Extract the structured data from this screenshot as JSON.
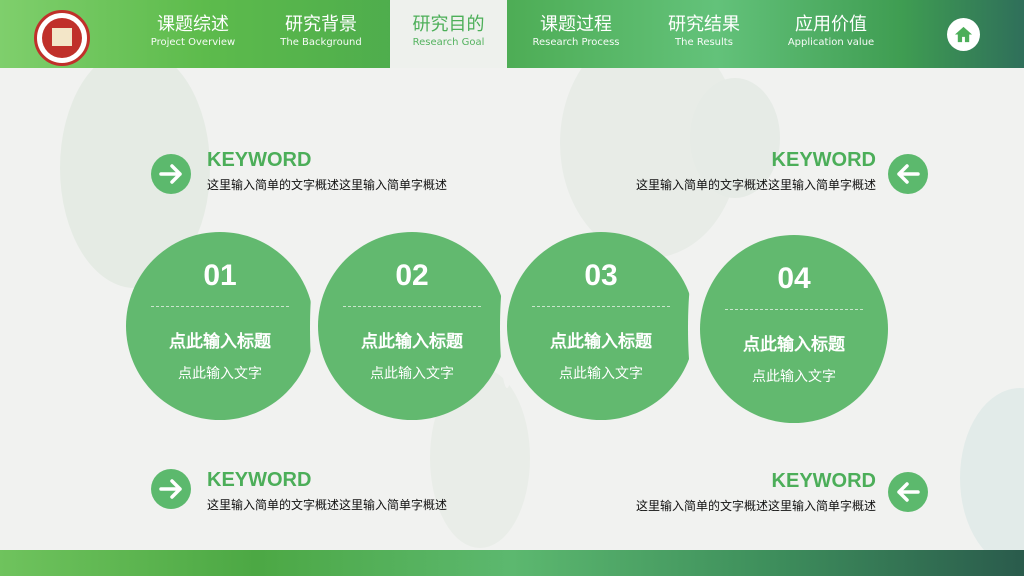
{
  "nav": {
    "items": [
      {
        "zh": "课题综述",
        "en": "Project Overview"
      },
      {
        "zh": "研究背景",
        "en": "The Background"
      },
      {
        "zh": "研究目的",
        "en": "Research Goal"
      },
      {
        "zh": "课题过程",
        "en": "Research Process"
      },
      {
        "zh": "研究结果",
        "en": "The Results"
      },
      {
        "zh": "应用价值",
        "en": "Application value"
      }
    ],
    "active_index": 2,
    "home_icon": "home-icon",
    "logo_icon": "university-seal-icon"
  },
  "keywords": [
    {
      "title": "KEYWORD",
      "desc": "这里输入简单的文字概述这里输入简单字概述",
      "icon": "arrow-right-icon"
    },
    {
      "title": "KEYWORD",
      "desc": "这里输入简单的文字概述这里输入简单字概述",
      "icon": "arrow-left-icon"
    },
    {
      "title": "KEYWORD",
      "desc": "这里输入简单的文字概述这里输入简单字概述",
      "icon": "arrow-right-icon"
    },
    {
      "title": "KEYWORD",
      "desc": "这里输入简单的文字概述这里输入简单字概述",
      "icon": "arrow-left-icon"
    }
  ],
  "steps": [
    {
      "num": "01",
      "title": "点此输入标题",
      "text": "点此输入文字"
    },
    {
      "num": "02",
      "title": "点此输入标题",
      "text": "点此输入文字"
    },
    {
      "num": "03",
      "title": "点此输入标题",
      "text": "点此输入文字"
    },
    {
      "num": "04",
      "title": "点此输入标题",
      "text": "点此输入文字"
    }
  ],
  "colors": {
    "accent": "#4cae59",
    "circle": "#62b96f",
    "arrow": "#5cb96d"
  }
}
